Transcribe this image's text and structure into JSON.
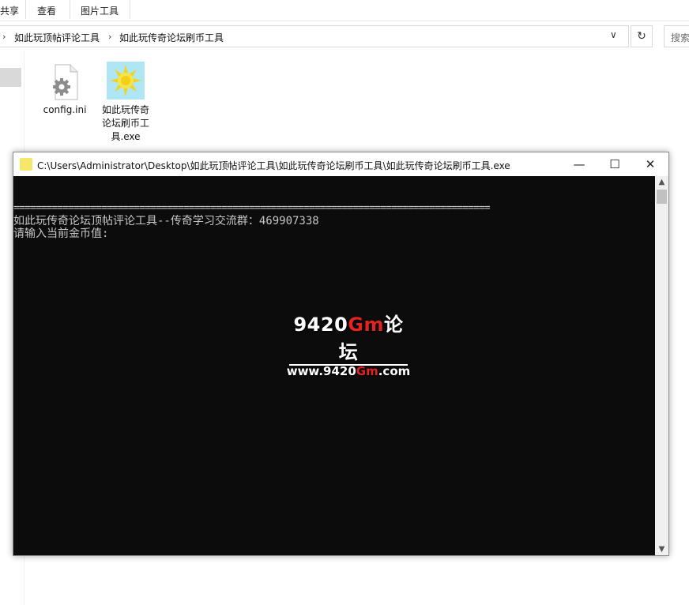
{
  "ribbon": {
    "tabs": [
      "共享",
      "查看",
      "图片工具"
    ]
  },
  "address_bar": {
    "breadcrumbs": [
      "如此玩顶帖评论工具",
      "如此玩传奇论坛刷币工具"
    ],
    "dropdown_icon": "chevron-down-icon",
    "refresh_icon": "refresh-icon"
  },
  "search": {
    "placeholder": "搜索"
  },
  "files": [
    {
      "name": "config.ini",
      "icon": "settings-file-icon"
    },
    {
      "name": "如此玩传奇论坛刷币工具.exe",
      "icon": "sun-app-icon"
    }
  ],
  "console": {
    "title": "C:\\Users\\Administrator\\Desktop\\如此玩顶帖评论工具\\如此玩传奇论坛刷币工具\\如此玩传奇论坛刷币工具.exe",
    "lines": [
      "=======================================================================================",
      "如此玩传奇论坛顶帖评论工具--传奇学习交流群：469907338",
      "请输入当前金币值:"
    ],
    "controls": {
      "minimize": "—",
      "maximize": "☐",
      "close": "✕"
    }
  },
  "watermark": {
    "line1_pre": "9420",
    "line1_red": "Gm",
    "line1_post": "论坛",
    "line2_pre": "www.9420",
    "line2_red": "Gm",
    "line2_post": ".com"
  },
  "colors": {
    "console_bg": "#0c0c0c",
    "console_text": "#c6c6c6",
    "watermark_red": "#e32222"
  }
}
